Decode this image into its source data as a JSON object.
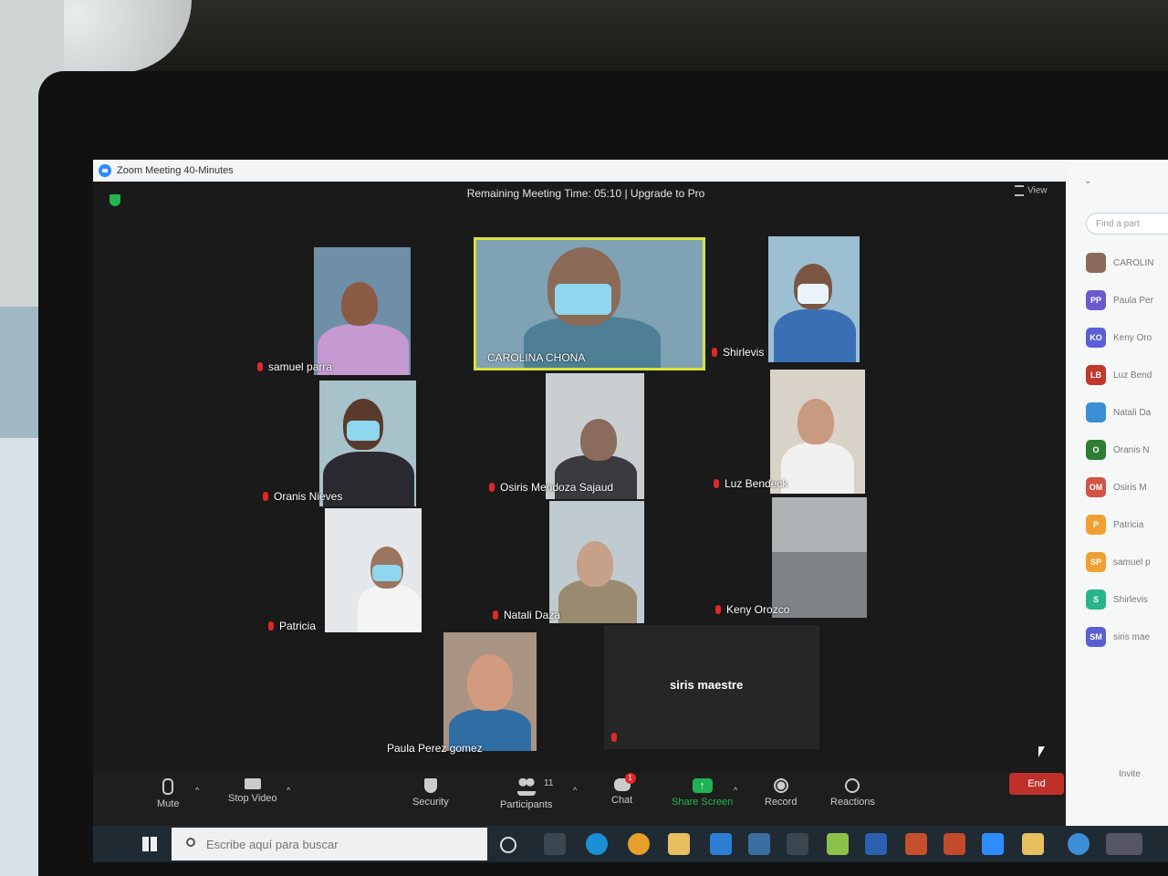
{
  "window": {
    "title": "Zoom Meeting 40-Minutes"
  },
  "meeting": {
    "timer_text": "Remaining Meeting Time: 05:10 | Upgrade to Pro",
    "view_label": "View"
  },
  "tiles": [
    {
      "name": "samuel parra",
      "muted": true,
      "active": false
    },
    {
      "name": "CAROLINA CHONA",
      "muted": false,
      "active": true
    },
    {
      "name": "Shirlevis",
      "muted": true,
      "active": false
    },
    {
      "name": "Oranis Nieves",
      "muted": true,
      "active": false
    },
    {
      "name": "Osiris Mendoza Sajaud",
      "muted": true,
      "active": false
    },
    {
      "name": "Luz Bendeck",
      "muted": true,
      "active": false
    },
    {
      "name": "Patricia",
      "muted": true,
      "active": false
    },
    {
      "name": "Natali Daza",
      "muted": true,
      "active": false
    },
    {
      "name": "Keny Orozco",
      "muted": true,
      "active": false
    },
    {
      "name": "Paula Perez gomez",
      "muted": false,
      "active": false
    },
    {
      "name": "siris maestre",
      "muted": true,
      "active": false,
      "video_off": true
    }
  ],
  "toolbar": {
    "mute": "Mute",
    "stop_video": "Stop Video",
    "security": "Security",
    "participants": "Participants",
    "participants_count": "11",
    "chat": "Chat",
    "chat_badge": "1",
    "share_screen": "Share Screen",
    "record": "Record",
    "reactions": "Reactions",
    "end": "End"
  },
  "panel": {
    "search_placeholder": "Find a part",
    "participants": [
      {
        "initials": "",
        "name": "CAROLIN",
        "color": "#8a6a5a"
      },
      {
        "initials": "PP",
        "name": "Paula Per",
        "color": "#6a5acd"
      },
      {
        "initials": "KO",
        "name": "Keny Oro",
        "color": "#5b5fd6"
      },
      {
        "initials": "LB",
        "name": "Luz Bend",
        "color": "#c0392b"
      },
      {
        "initials": "",
        "name": "Natali Da",
        "color": "#3a8fd6"
      },
      {
        "initials": "O",
        "name": "Oranis N",
        "color": "#2e7d32"
      },
      {
        "initials": "OM",
        "name": "Osiris M",
        "color": "#d35445"
      },
      {
        "initials": "P",
        "name": "Patricia",
        "color": "#f0a030"
      },
      {
        "initials": "SP",
        "name": "samuel p",
        "color": "#f0a030"
      },
      {
        "initials": "S",
        "name": "Shirlevis",
        "color": "#28b58a"
      },
      {
        "initials": "SM",
        "name": "siris mae",
        "color": "#5b5fd6"
      }
    ],
    "invite": "Invite"
  },
  "taskbar": {
    "search_placeholder": "Escribe aquí para buscar"
  }
}
